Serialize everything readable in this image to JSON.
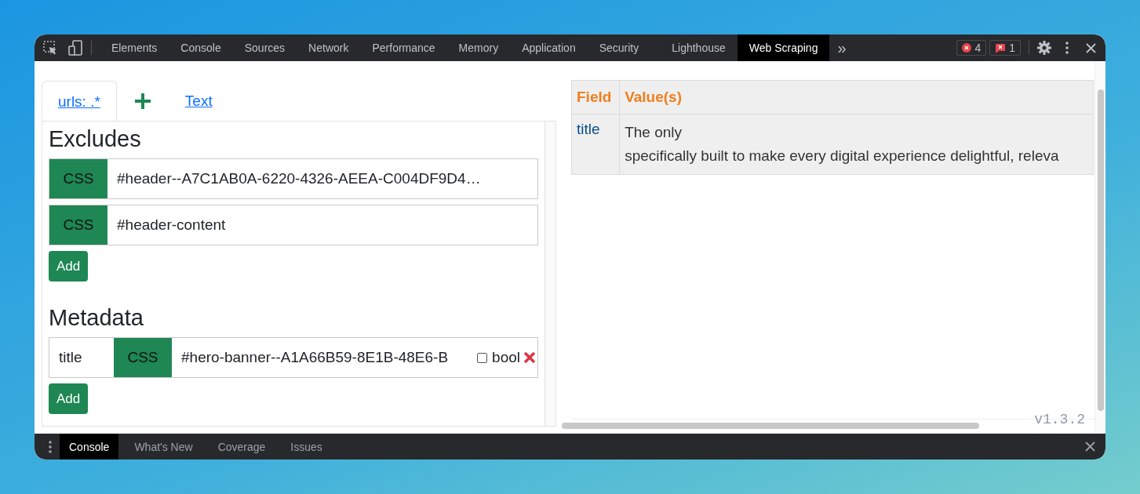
{
  "toolbar": {
    "tabs": [
      {
        "label": "Elements",
        "selected": false
      },
      {
        "label": "Console",
        "selected": false
      },
      {
        "label": "Sources",
        "selected": false
      },
      {
        "label": "Network",
        "selected": false
      },
      {
        "label": "Performance",
        "selected": false
      },
      {
        "label": "Memory",
        "selected": false
      },
      {
        "label": "Application",
        "selected": false
      },
      {
        "label": "Security",
        "selected": false
      },
      {
        "label": "Lighthouse",
        "selected": false
      },
      {
        "label": "Web Scraping",
        "selected": true
      }
    ],
    "more": "»",
    "error_count": "4",
    "issue_count": "1"
  },
  "editor": {
    "tabs": [
      {
        "kind": "link",
        "label": "urls: .*",
        "selected": true
      },
      {
        "kind": "add",
        "selected": false
      },
      {
        "kind": "link",
        "label": "Text",
        "selected": false
      }
    ],
    "excludes": {
      "heading": "Excludes",
      "rules": [
        {
          "type": "CSS",
          "value": "#header--A7C1AB0A-6220-4326-AEEA-C004DF9D4…"
        },
        {
          "type": "CSS",
          "value": "#header-content"
        }
      ],
      "add_button": "Add"
    },
    "metadata": {
      "heading": "Metadata",
      "rows": [
        {
          "name": "title",
          "type": "CSS",
          "selector": "#hero-banner--A1A66B59-8E1B-48E6-B",
          "checked": false,
          "checkbox_label": "bool"
        }
      ],
      "add_button": "Add"
    }
  },
  "results": {
    "columns": [
      "Field",
      "Value(s)"
    ],
    "rows": [
      {
        "field": "title",
        "values": [
          "The only",
          "specifically built to make every digital experience delightful, releva"
        ]
      }
    ],
    "version": "v1.3.2"
  },
  "drawer": {
    "tabs": [
      {
        "label": "Console",
        "selected": true
      },
      {
        "label": "What's New",
        "selected": false
      },
      {
        "label": "Coverage",
        "selected": false
      },
      {
        "label": "Issues",
        "selected": false
      }
    ]
  }
}
